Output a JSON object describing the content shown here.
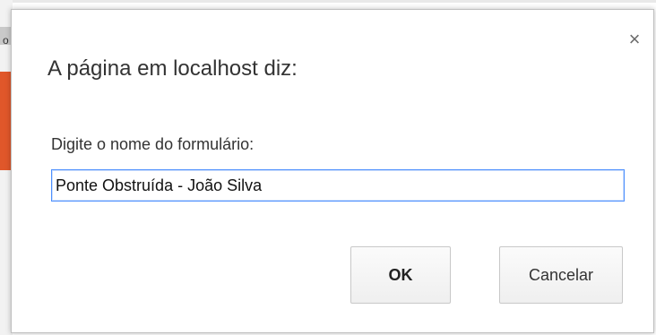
{
  "dialog": {
    "title": "A página em localhost diz:",
    "prompt": "Digite o nome do formulário:",
    "input_value": "Ponte Obstruída - João Silva",
    "ok_label": "OK",
    "cancel_label": "Cancelar",
    "close_symbol": "×"
  },
  "background": {
    "edge_text": "o"
  },
  "colors": {
    "focus_border": "#4d90fe",
    "background_accent": "#e0572a"
  },
  "icons": {
    "close": "close-icon"
  }
}
